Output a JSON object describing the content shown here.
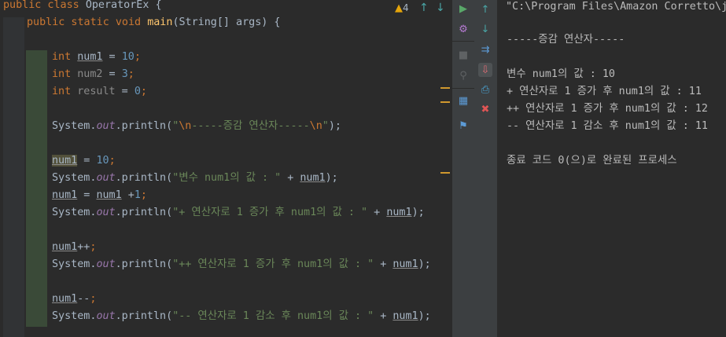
{
  "editor": {
    "warning_count": "4",
    "line_class": {
      "kw": "public class",
      "name": "OperatorEx",
      "brace": " {"
    },
    "line_main": {
      "kw": "public static void",
      "fn": "main",
      "rest": "(String[] args) {"
    },
    "decl1": {
      "kw": "int",
      "var": "num1",
      "rest": " = ",
      "val": "10",
      "end": ";"
    },
    "decl2": {
      "kw": "int",
      "var": "num2",
      "rest": " = ",
      "val": "3",
      "end": ";"
    },
    "decl3": {
      "kw": "int",
      "var": "result",
      "rest": " = ",
      "val": "0",
      "end": ";"
    },
    "print1": {
      "pre": "System.",
      "out": "out",
      "mid": ".println(",
      "q1": "\"",
      "esc1": "\\n",
      "text": "-----증감 연산자-----",
      "esc2": "\\n",
      "q2": "\"",
      "end": ");"
    },
    "assign1": {
      "var": "num1",
      "rest": " = ",
      "val": "10",
      "end": ";"
    },
    "print2": {
      "pre": "System.",
      "out": "out",
      "mid": ".println(",
      "str": "\"변수 num1의 값 : \"",
      "plus": " + ",
      "var": "num1",
      "end": ");"
    },
    "assign2": {
      "var": "num1",
      "rest": " = ",
      "var2": "num1",
      "op": " +",
      "val": "1",
      "end": ";"
    },
    "print3": {
      "pre": "System.",
      "out": "out",
      "mid": ".println(",
      "str": "\"+ 연산자로 1 증가 후 num1의 값 : \"",
      "plus": " + ",
      "var": "num1",
      "end": ");"
    },
    "inc": {
      "var": "num1",
      "op": "++",
      "end": ";"
    },
    "print4": {
      "pre": "System.",
      "out": "out",
      "mid": ".println(",
      "str": "\"++ 연산자로 1 증가 후 num1의 값 : \"",
      "plus": " + ",
      "var": "num1",
      "end": ");"
    },
    "dec": {
      "var": "num1",
      "op": "--",
      "end": ";"
    },
    "print5": {
      "pre": "System.",
      "out": "out",
      "mid": ".println(",
      "str": "\"-- 연산자로 1 감소 후 num1의 값 : \"",
      "plus": " + ",
      "var": "num1",
      "end": ");"
    }
  },
  "console": {
    "lines": [
      "\"C:\\Program Files\\Amazon Corretto\\j",
      "",
      "-----증감 연산자-----",
      "",
      "변수 num1의 값 : 10",
      "+ 연산자로 1 증가 후 num1의 값 : 11",
      "++ 연산자로 1 증가 후 num1의 값 : 12",
      "-- 연산자로 1 감소 후 num1의 값 : 11",
      "",
      "종료 코드 0(으)로 완료된 프로세스"
    ]
  },
  "colors": {
    "background": "#2b2b2b",
    "keyword": "#cc7832",
    "string": "#6a8759",
    "number": "#6897bb",
    "function": "#ffc66d",
    "field": "#9876aa",
    "run_green": "#59a869",
    "stop_red": "#e05555",
    "accent_teal": "#4aa6a6"
  },
  "icons": {
    "warning": "warning-triangle-icon",
    "prev": "arrow-up-icon",
    "next": "arrow-down-icon",
    "run": "run-icon",
    "settings": "gear-icon",
    "stop": "stop-icon",
    "attach": "attach-debugger-icon",
    "layout": "layout-icon",
    "pin": "pin-icon",
    "up": "arrow-up-icon",
    "down": "arrow-down-icon",
    "wrap": "soft-wrap-icon",
    "scroll_end": "scroll-to-end-icon",
    "print": "print-icon",
    "clear": "trash-icon"
  }
}
